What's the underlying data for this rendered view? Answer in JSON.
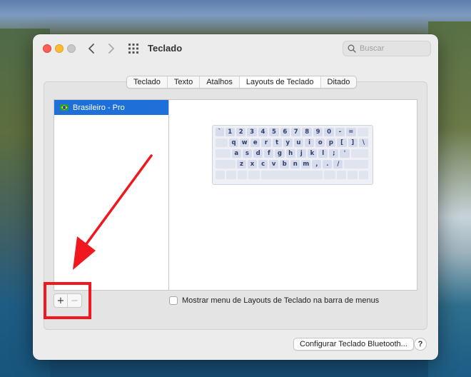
{
  "window": {
    "title": "Teclado"
  },
  "search": {
    "placeholder": "Buscar"
  },
  "tabs": [
    {
      "label": "Teclado",
      "active": false
    },
    {
      "label": "Texto",
      "active": false
    },
    {
      "label": "Atalhos",
      "active": false
    },
    {
      "label": "Layouts de Teclado",
      "active": true
    },
    {
      "label": "Ditado",
      "active": false
    }
  ],
  "layouts": {
    "items": [
      {
        "label": "Brasileiro - Pro",
        "selected": true
      }
    ],
    "add_label": "+",
    "remove_label": "−"
  },
  "keyboard": {
    "rows": [
      [
        "`",
        "1",
        "2",
        "3",
        "4",
        "5",
        "6",
        "7",
        "8",
        "9",
        "0",
        "-",
        "="
      ],
      [
        "q",
        "w",
        "e",
        "r",
        "t",
        "y",
        "u",
        "i",
        "o",
        "p",
        "[",
        "]",
        "\\"
      ],
      [
        "a",
        "s",
        "d",
        "f",
        "g",
        "h",
        "j",
        "k",
        "l",
        ";",
        "'"
      ],
      [
        "z",
        "x",
        "c",
        "v",
        "b",
        "n",
        "m",
        ",",
        ".",
        "/"
      ]
    ]
  },
  "options": {
    "show_menu_label": "Mostrar menu de Layouts de Teclado na barra de menus",
    "show_menu_checked": false
  },
  "footer": {
    "bluetooth_label": "Configurar Teclado Bluetooth...",
    "help_label": "?"
  },
  "annotation": {
    "color": "#f0171e"
  },
  "icons": {
    "back": "chevron-left-icon",
    "forward": "chevron-right-icon",
    "grid": "grid-icon",
    "search": "search-icon",
    "flag": "brazil-flag-icon"
  }
}
